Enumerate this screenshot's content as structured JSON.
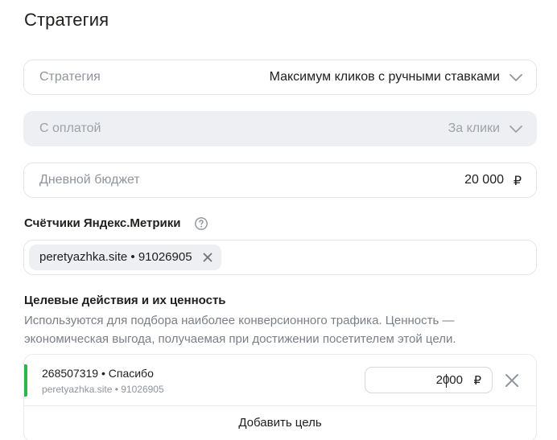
{
  "page": {
    "title": "Стратегия"
  },
  "strategy_field": {
    "label": "Стратегия",
    "value": "Максимум кликов с ручными ставками",
    "icon": "chevron-down-icon"
  },
  "payment_field": {
    "label": "С оплатой",
    "value": "За клики",
    "icon": "chevron-down-icon",
    "disabled": true
  },
  "budget_field": {
    "label": "Дневной бюджет",
    "value": "20 000",
    "currency": "₽"
  },
  "counters": {
    "label": "Счётчики Яндекс.Метрики",
    "help_icon": "question-circle-icon",
    "chips": [
      {
        "label": "peretyazhka.site • 91026905",
        "remove_icon": "close-icon"
      }
    ]
  },
  "goals": {
    "label": "Целевые действия и их ценность",
    "description": "Используются для подбора наиболее конверсионного трафика. Ценность — экономическая выгода, получаемая при достижении посетителем этой цели.",
    "items": [
      {
        "name": "268507319 • Спасибо",
        "source": "peretyazhka.site • 91026905",
        "value": "2000",
        "currency": "₽",
        "accent_color": "#2fb64a",
        "remove_icon": "close-icon"
      }
    ],
    "add_label": "Добавить цель"
  }
}
